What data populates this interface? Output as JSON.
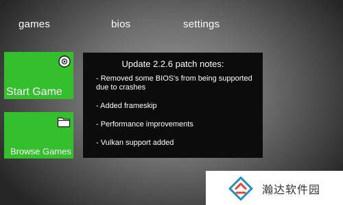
{
  "nav": {
    "tabs": [
      {
        "label": "games"
      },
      {
        "label": "bios"
      },
      {
        "label": "settings"
      }
    ]
  },
  "tiles": {
    "start": {
      "label": "Start Game",
      "icon": "disc-icon"
    },
    "browse": {
      "label": "Browse Games",
      "icon": "folder-icon"
    },
    "color": "#33c02c"
  },
  "notes": {
    "title": "Update 2.2.6 patch notes:",
    "items": [
      "- Removed some BIOS's from being supported due to crashes",
      "- Added frameskip",
      "- Performance improvements",
      "- Vulkan support added"
    ]
  },
  "watermark": {
    "text": "瀚达软件园",
    "colors": [
      "#1a8ec9",
      "#e8432f"
    ]
  }
}
